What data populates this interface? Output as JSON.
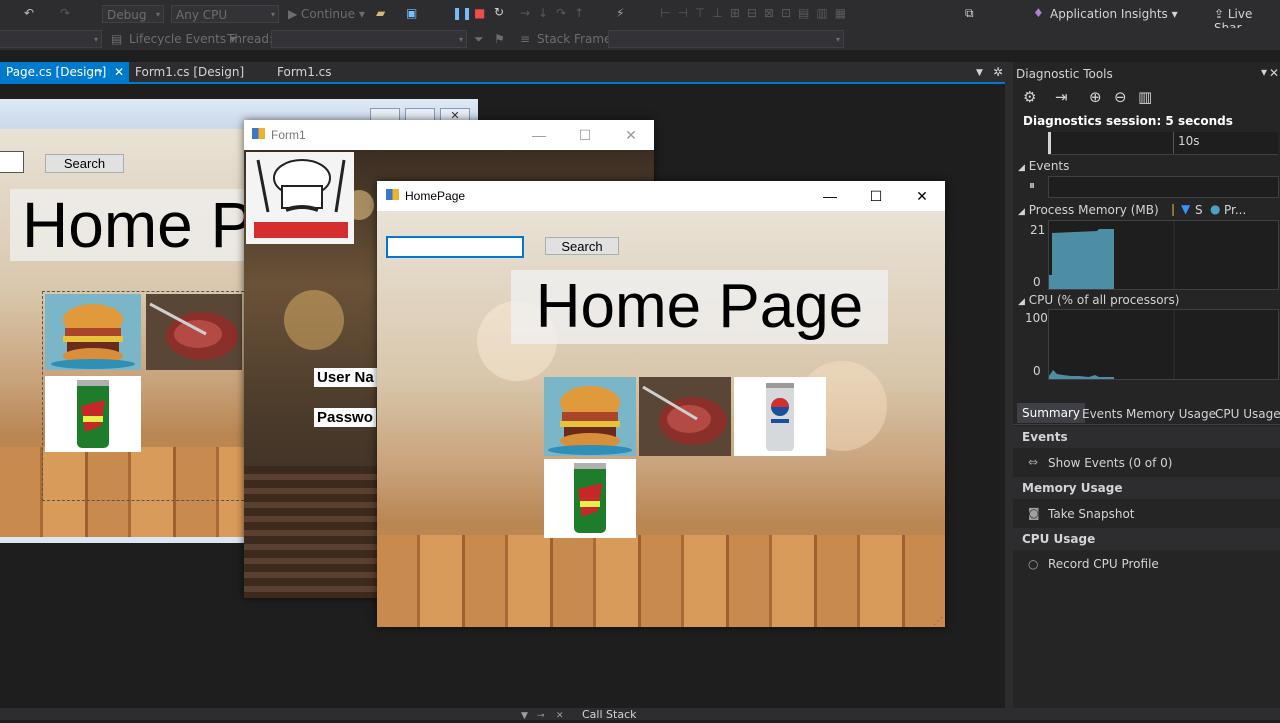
{
  "toolbar": {
    "config": "Debug",
    "platform": "Any CPU",
    "continue_label": "Continue",
    "app_insights": "Application Insights",
    "live_share": "Live Shar",
    "lifecycle_events": "Lifecycle Events",
    "thread_label": "Thread:",
    "stack_frame_label": "Stack Frame:"
  },
  "tabs": [
    {
      "label": "Page.cs [Design]",
      "active": true
    },
    {
      "label": "Form1.cs [Design]",
      "active": false
    },
    {
      "label": "Form1.cs",
      "active": false
    }
  ],
  "designer": {
    "search_label": "Search",
    "heading": "Home Pa"
  },
  "form1": {
    "title": "Form1",
    "user_label": "User Na",
    "password_label": "Passwo"
  },
  "homepage": {
    "title": "HomePage",
    "search_placeholder": "",
    "search_label": "Search",
    "heading": "Home Page"
  },
  "diagnostics": {
    "title": "Diagnostic Tools",
    "session": "Diagnostics session: 5 seconds",
    "timeline_tick": "10s",
    "events_header": "Events",
    "memory_header": "Process Memory (MB)",
    "memory_legend_s": "S",
    "memory_legend_pr": "Pr...",
    "memory_max": "21",
    "memory_min": "0",
    "cpu_header": "CPU (% of all processors)",
    "cpu_max": "100",
    "cpu_min": "0",
    "tabs": [
      "Summary",
      "Events",
      "Memory Usage",
      "CPU Usage"
    ],
    "events_section": "Events",
    "show_events": "Show Events (0 of 0)",
    "memory_section": "Memory Usage",
    "take_snapshot": "Take Snapshot",
    "cpu_section": "CPU Usage",
    "record_cpu": "Record CPU Profile"
  },
  "bottom": {
    "call_stack": "Call Stack"
  },
  "colors": {
    "accent": "#007acc",
    "ide_bg": "#1e1e1e",
    "panel_bg": "#252526",
    "memory_fill": "#4d8ea5"
  }
}
